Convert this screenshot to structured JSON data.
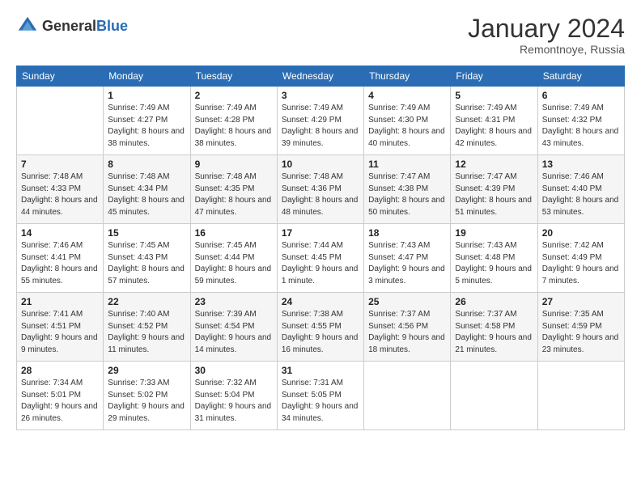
{
  "header": {
    "logo": {
      "general": "General",
      "blue": "Blue"
    },
    "title": "January 2024",
    "location": "Remontnoye, Russia"
  },
  "weekdays": [
    "Sunday",
    "Monday",
    "Tuesday",
    "Wednesday",
    "Thursday",
    "Friday",
    "Saturday"
  ],
  "weeks": [
    [
      {
        "day": "",
        "sunrise": "",
        "sunset": "",
        "daylight": ""
      },
      {
        "day": "1",
        "sunrise": "Sunrise: 7:49 AM",
        "sunset": "Sunset: 4:27 PM",
        "daylight": "Daylight: 8 hours and 38 minutes."
      },
      {
        "day": "2",
        "sunrise": "Sunrise: 7:49 AM",
        "sunset": "Sunset: 4:28 PM",
        "daylight": "Daylight: 8 hours and 38 minutes."
      },
      {
        "day": "3",
        "sunrise": "Sunrise: 7:49 AM",
        "sunset": "Sunset: 4:29 PM",
        "daylight": "Daylight: 8 hours and 39 minutes."
      },
      {
        "day": "4",
        "sunrise": "Sunrise: 7:49 AM",
        "sunset": "Sunset: 4:30 PM",
        "daylight": "Daylight: 8 hours and 40 minutes."
      },
      {
        "day": "5",
        "sunrise": "Sunrise: 7:49 AM",
        "sunset": "Sunset: 4:31 PM",
        "daylight": "Daylight: 8 hours and 42 minutes."
      },
      {
        "day": "6",
        "sunrise": "Sunrise: 7:49 AM",
        "sunset": "Sunset: 4:32 PM",
        "daylight": "Daylight: 8 hours and 43 minutes."
      }
    ],
    [
      {
        "day": "7",
        "sunrise": "Sunrise: 7:48 AM",
        "sunset": "Sunset: 4:33 PM",
        "daylight": "Daylight: 8 hours and 44 minutes."
      },
      {
        "day": "8",
        "sunrise": "Sunrise: 7:48 AM",
        "sunset": "Sunset: 4:34 PM",
        "daylight": "Daylight: 8 hours and 45 minutes."
      },
      {
        "day": "9",
        "sunrise": "Sunrise: 7:48 AM",
        "sunset": "Sunset: 4:35 PM",
        "daylight": "Daylight: 8 hours and 47 minutes."
      },
      {
        "day": "10",
        "sunrise": "Sunrise: 7:48 AM",
        "sunset": "Sunset: 4:36 PM",
        "daylight": "Daylight: 8 hours and 48 minutes."
      },
      {
        "day": "11",
        "sunrise": "Sunrise: 7:47 AM",
        "sunset": "Sunset: 4:38 PM",
        "daylight": "Daylight: 8 hours and 50 minutes."
      },
      {
        "day": "12",
        "sunrise": "Sunrise: 7:47 AM",
        "sunset": "Sunset: 4:39 PM",
        "daylight": "Daylight: 8 hours and 51 minutes."
      },
      {
        "day": "13",
        "sunrise": "Sunrise: 7:46 AM",
        "sunset": "Sunset: 4:40 PM",
        "daylight": "Daylight: 8 hours and 53 minutes."
      }
    ],
    [
      {
        "day": "14",
        "sunrise": "Sunrise: 7:46 AM",
        "sunset": "Sunset: 4:41 PM",
        "daylight": "Daylight: 8 hours and 55 minutes."
      },
      {
        "day": "15",
        "sunrise": "Sunrise: 7:45 AM",
        "sunset": "Sunset: 4:43 PM",
        "daylight": "Daylight: 8 hours and 57 minutes."
      },
      {
        "day": "16",
        "sunrise": "Sunrise: 7:45 AM",
        "sunset": "Sunset: 4:44 PM",
        "daylight": "Daylight: 8 hours and 59 minutes."
      },
      {
        "day": "17",
        "sunrise": "Sunrise: 7:44 AM",
        "sunset": "Sunset: 4:45 PM",
        "daylight": "Daylight: 9 hours and 1 minute."
      },
      {
        "day": "18",
        "sunrise": "Sunrise: 7:43 AM",
        "sunset": "Sunset: 4:47 PM",
        "daylight": "Daylight: 9 hours and 3 minutes."
      },
      {
        "day": "19",
        "sunrise": "Sunrise: 7:43 AM",
        "sunset": "Sunset: 4:48 PM",
        "daylight": "Daylight: 9 hours and 5 minutes."
      },
      {
        "day": "20",
        "sunrise": "Sunrise: 7:42 AM",
        "sunset": "Sunset: 4:49 PM",
        "daylight": "Daylight: 9 hours and 7 minutes."
      }
    ],
    [
      {
        "day": "21",
        "sunrise": "Sunrise: 7:41 AM",
        "sunset": "Sunset: 4:51 PM",
        "daylight": "Daylight: 9 hours and 9 minutes."
      },
      {
        "day": "22",
        "sunrise": "Sunrise: 7:40 AM",
        "sunset": "Sunset: 4:52 PM",
        "daylight": "Daylight: 9 hours and 11 minutes."
      },
      {
        "day": "23",
        "sunrise": "Sunrise: 7:39 AM",
        "sunset": "Sunset: 4:54 PM",
        "daylight": "Daylight: 9 hours and 14 minutes."
      },
      {
        "day": "24",
        "sunrise": "Sunrise: 7:38 AM",
        "sunset": "Sunset: 4:55 PM",
        "daylight": "Daylight: 9 hours and 16 minutes."
      },
      {
        "day": "25",
        "sunrise": "Sunrise: 7:37 AM",
        "sunset": "Sunset: 4:56 PM",
        "daylight": "Daylight: 9 hours and 18 minutes."
      },
      {
        "day": "26",
        "sunrise": "Sunrise: 7:37 AM",
        "sunset": "Sunset: 4:58 PM",
        "daylight": "Daylight: 9 hours and 21 minutes."
      },
      {
        "day": "27",
        "sunrise": "Sunrise: 7:35 AM",
        "sunset": "Sunset: 4:59 PM",
        "daylight": "Daylight: 9 hours and 23 minutes."
      }
    ],
    [
      {
        "day": "28",
        "sunrise": "Sunrise: 7:34 AM",
        "sunset": "Sunset: 5:01 PM",
        "daylight": "Daylight: 9 hours and 26 minutes."
      },
      {
        "day": "29",
        "sunrise": "Sunrise: 7:33 AM",
        "sunset": "Sunset: 5:02 PM",
        "daylight": "Daylight: 9 hours and 29 minutes."
      },
      {
        "day": "30",
        "sunrise": "Sunrise: 7:32 AM",
        "sunset": "Sunset: 5:04 PM",
        "daylight": "Daylight: 9 hours and 31 minutes."
      },
      {
        "day": "31",
        "sunrise": "Sunrise: 7:31 AM",
        "sunset": "Sunset: 5:05 PM",
        "daylight": "Daylight: 9 hours and 34 minutes."
      },
      {
        "day": "",
        "sunrise": "",
        "sunset": "",
        "daylight": ""
      },
      {
        "day": "",
        "sunrise": "",
        "sunset": "",
        "daylight": ""
      },
      {
        "day": "",
        "sunrise": "",
        "sunset": "",
        "daylight": ""
      }
    ]
  ]
}
